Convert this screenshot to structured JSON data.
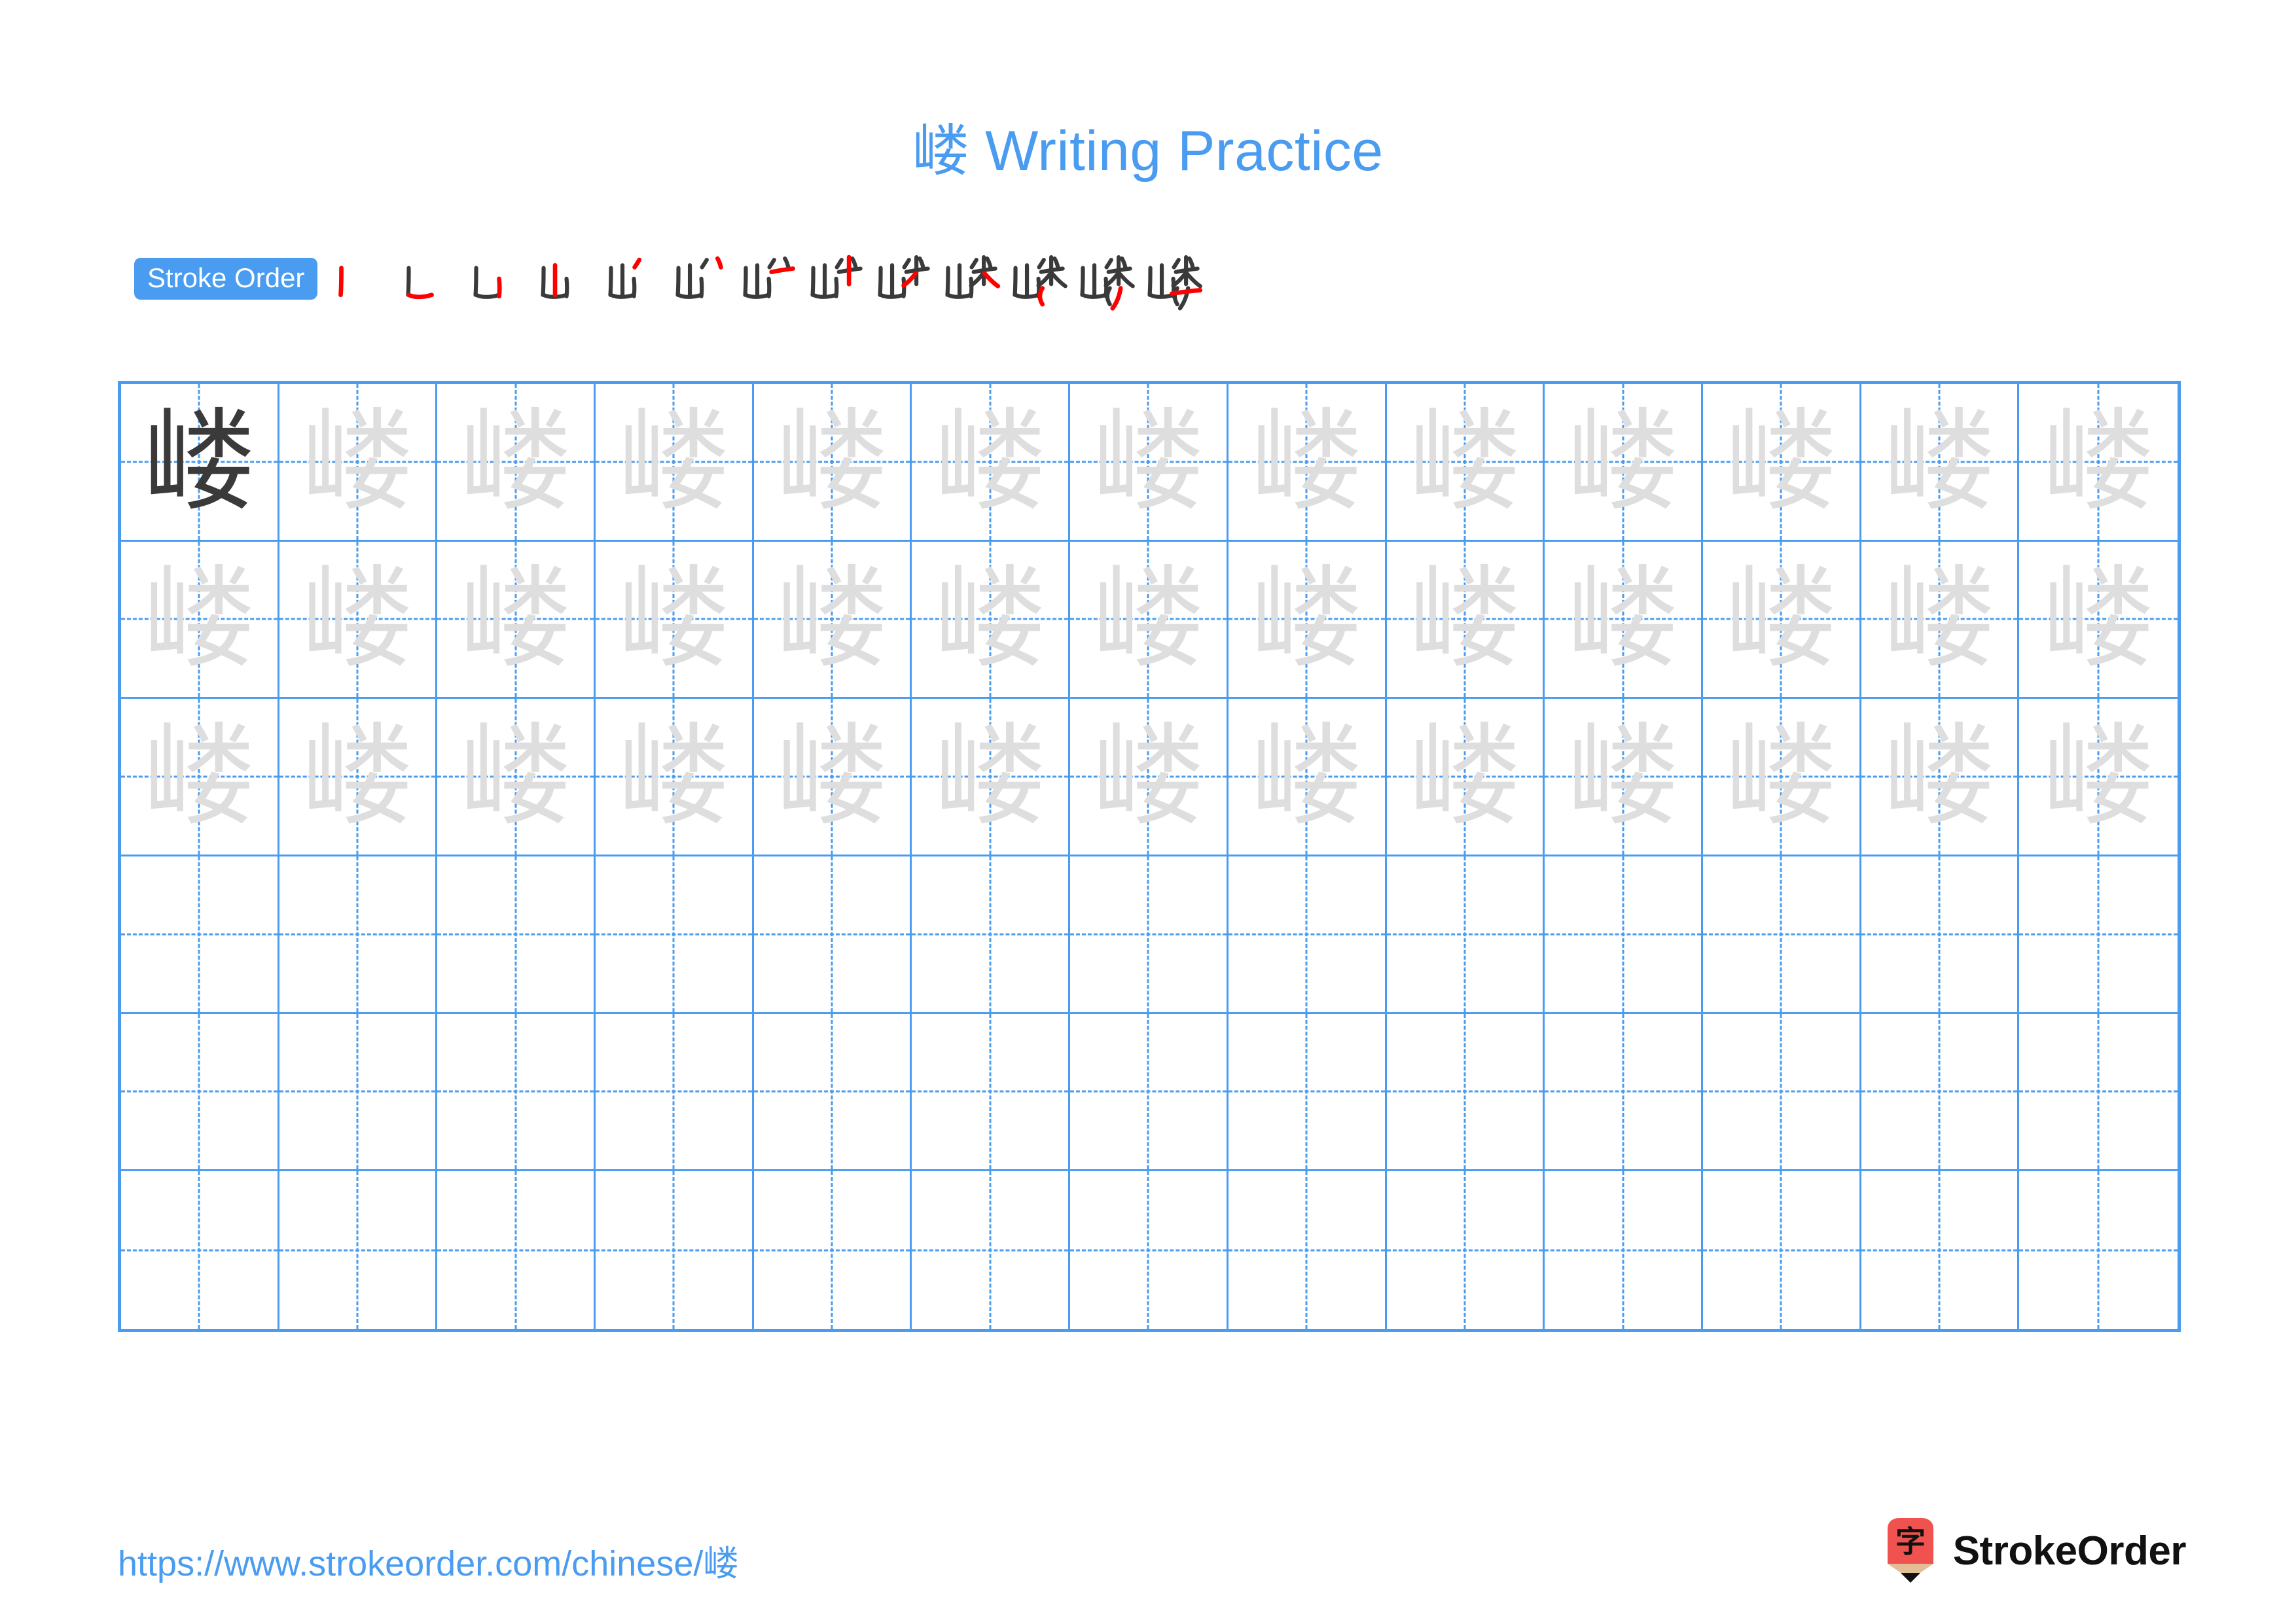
{
  "document": {
    "character": "嵝",
    "title": "嵝 Writing Practice",
    "title_suffix": " Writing Practice"
  },
  "colors": {
    "accent_blue": "#4a9cf0",
    "grid_line": "#4a9cf0",
    "stroke_new": "#ff0000",
    "stroke_old": "#3a3a3a",
    "traced_char": "#dedede",
    "solid_char": "#3a3a3a",
    "logo_red": "#f0534f",
    "logo_wood": "#e3bd95",
    "logo_tip": "#111111",
    "brand_text": "#111111"
  },
  "stroke_order": {
    "label": "Stroke Order",
    "total_strokes": 13,
    "steps": [
      {
        "index": 1,
        "partial": "丨",
        "new_stroke": "vertical"
      },
      {
        "index": 2,
        "partial": "凵",
        "new_stroke": "vertical-turn-horizontal"
      },
      {
        "index": 3,
        "partial": "山",
        "new_stroke": "vertical"
      },
      {
        "index": 4,
        "partial": "屮丶",
        "new_stroke": "dot"
      },
      {
        "index": 5,
        "partial": "山丷",
        "new_stroke": "left-falling"
      },
      {
        "index": 6,
        "partial": "屵",
        "new_stroke": "horizontal"
      },
      {
        "index": 7,
        "partial": "屮十",
        "new_stroke": "vertical"
      },
      {
        "index": 8,
        "partial": "屮米",
        "new_stroke": "left-falling"
      },
      {
        "index": 9,
        "partial": "屮米",
        "new_stroke": "right-falling"
      },
      {
        "index": 10,
        "partial": "嵝",
        "new_stroke": "left-falling-dot"
      },
      {
        "index": 11,
        "partial": "嵝",
        "new_stroke": "curved-hook"
      },
      {
        "index": 12,
        "partial": "嵝",
        "new_stroke": "right-falling"
      },
      {
        "index": 13,
        "partial": "嵝",
        "new_stroke": "horizontal"
      }
    ]
  },
  "grid": {
    "columns": 13,
    "rows": 6,
    "cells": [
      [
        "solid",
        "traced",
        "traced",
        "traced",
        "traced",
        "traced",
        "traced",
        "traced",
        "traced",
        "traced",
        "traced",
        "traced",
        "traced"
      ],
      [
        "traced",
        "traced",
        "traced",
        "traced",
        "traced",
        "traced",
        "traced",
        "traced",
        "traced",
        "traced",
        "traced",
        "traced",
        "traced"
      ],
      [
        "traced",
        "traced",
        "traced",
        "traced",
        "traced",
        "traced",
        "traced",
        "traced",
        "traced",
        "traced",
        "traced",
        "traced",
        "traced"
      ],
      [
        "empty",
        "empty",
        "empty",
        "empty",
        "empty",
        "empty",
        "empty",
        "empty",
        "empty",
        "empty",
        "empty",
        "empty",
        "empty"
      ],
      [
        "empty",
        "empty",
        "empty",
        "empty",
        "empty",
        "empty",
        "empty",
        "empty",
        "empty",
        "empty",
        "empty",
        "empty",
        "empty"
      ],
      [
        "empty",
        "empty",
        "empty",
        "empty",
        "empty",
        "empty",
        "empty",
        "empty",
        "empty",
        "empty",
        "empty",
        "empty",
        "empty"
      ]
    ]
  },
  "footer": {
    "url": "https://www.strokeorder.com/chinese/嵝",
    "brand_name": "StrokeOrder",
    "logo_char": "字"
  }
}
